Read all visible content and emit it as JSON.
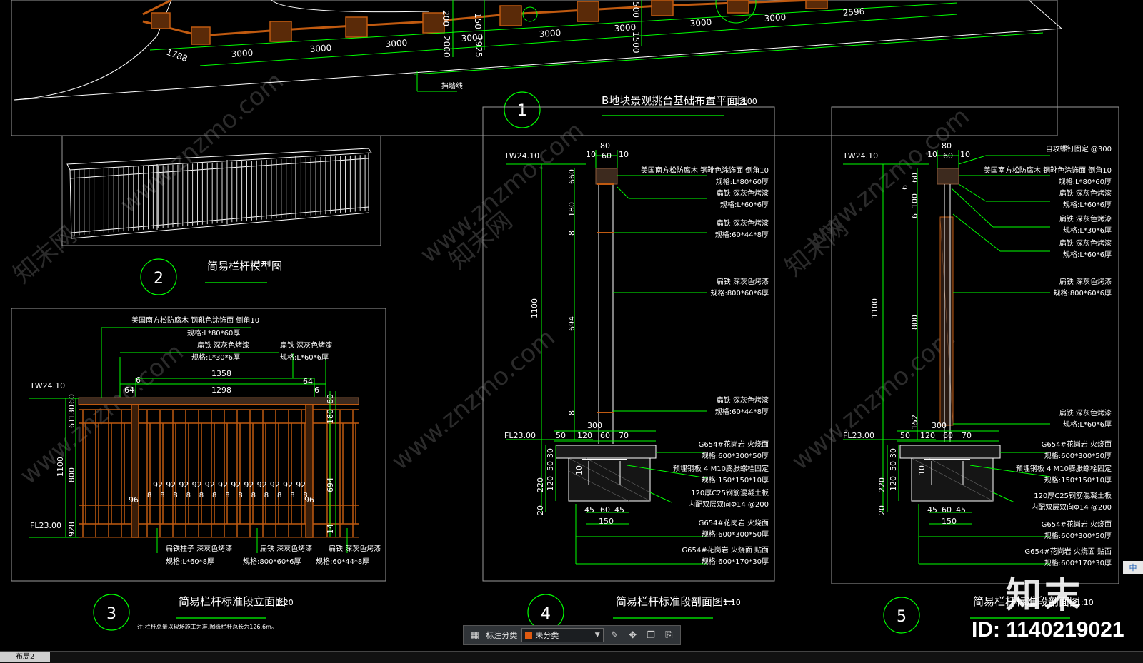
{
  "colors": {
    "line": "#ffffff",
    "dim": "#00ff00",
    "wood": "#c05a10",
    "hatch": "#8a5a3a",
    "frame": "#9a9a9a",
    "accent": "#e05a10"
  },
  "plan": {
    "dims_bottom": [
      "1788",
      "3000",
      "3000",
      "3000",
      "3000",
      "3000",
      "3000",
      "3000",
      "2596"
    ],
    "dims_mid": [
      "200",
      "150",
      "2000",
      "3000",
      "1925",
      "500",
      "1500"
    ],
    "marker": "1",
    "title": "B地块景观挑台基础布置平面图",
    "scale": "1:100",
    "note": "挡墙线"
  },
  "model": {
    "marker": "2",
    "title": "简易栏杆模型图"
  },
  "elevation": {
    "marker": "3",
    "title": "简易栏杆标准段立面图",
    "scale": "1:20",
    "note": "注:栏杆总量以现场施工为准,图纸栏杆总长为126.6m。",
    "top_label": "TW24.10",
    "bottom_label": "FL23.00",
    "labels": {
      "wood_top": "美国南方松防腐木 钢靴色涂饰面 倒角10",
      "wood_spec": "规格:L*80*60厚",
      "flat_a": "扁铁 深灰色烤漆",
      "flat_a_spec": "规格:L*30*6厚",
      "flat_b": "扁铁 深灰色烤漆",
      "flat_b_spec": "规格:L*60*6厚",
      "post": "扁铁柱子 深灰色烤漆",
      "post_spec": "规格:L*60*8厚",
      "bar": "扁铁 深灰色烤漆",
      "bar_spec": "规格:800*60*6厚",
      "base": "扁铁 深灰色烤漆",
      "base_spec": "规格:60*44*8厚"
    },
    "dims": {
      "d1358": "1358",
      "d1298": "1298",
      "d64a": "64",
      "d64b": "64",
      "d6": "6",
      "d6b": "6",
      "d1100": "1100",
      "d800": "800",
      "d60": "60",
      "d130": "130",
      "d61": "61",
      "d928": "928",
      "d694": "694",
      "d180": "180",
      "d96a": "96",
      "d96b": "96",
      "d14": "14"
    },
    "spacing": [
      "92",
      "92",
      "92",
      "92",
      "92",
      "92",
      "92",
      "92",
      "92",
      "92",
      "92",
      "92"
    ],
    "eights": [
      "8",
      "8",
      "8",
      "8",
      "8",
      "8",
      "8",
      "8",
      "8",
      "8",
      "8",
      "8",
      "8"
    ]
  },
  "section1": {
    "marker": "4",
    "title": "简易栏杆标准段剖面图一",
    "scale": "1:10",
    "top_label": "TW24.10",
    "bottom_label": "FL23.00",
    "dims": {
      "d80": "80",
      "d10a": "10",
      "d60": "60",
      "d10b": "10",
      "d660": "660",
      "d180": "180",
      "d8a": "8",
      "d1100": "1100",
      "d694": "694",
      "d8b": "8",
      "d300": "300",
      "d50": "50",
      "d120": "120",
      "d60b": "60",
      "d70": "70",
      "d30": "30",
      "d50b": "50",
      "d220": "220",
      "d120b": "120",
      "d20": "20",
      "d45a": "45",
      "d60c": "60",
      "d45b": "45",
      "d150": "150",
      "d10c": "10"
    },
    "labels": [
      "美国南方松防腐木 钢靴色涂饰面 倒角10",
      "规格:L*80*60厚",
      "扁铁 深灰色烤漆",
      "规格:L*60*6厚",
      "扁铁 深灰色烤漆",
      "规格:60*44*8厚",
      "扁铁 深灰色烤漆",
      "规格:800*60*6厚",
      "扁铁 深灰色烤漆",
      "规格:60*44*8厚",
      "G654#花岗岩 火烧面",
      "规格:600*300*50厚",
      "预埋钢板 4 M10膨胀螺栓固定",
      "规格:150*150*10厚",
      "120厚C25钢筋混凝土板",
      "内配双层双向Φ14 @200",
      "G654#花岗岩 火烧面",
      "规格:600*300*50厚",
      "G654#花岗岩 火烧面 贴面",
      "规格:600*170*30厚"
    ]
  },
  "section2": {
    "marker": "5",
    "title": "简易栏杆标准段剖面图",
    "scale": "1:10",
    "top_label": "TW24.10",
    "bottom_label": "FL23.00",
    "dims": {
      "d80": "80",
      "d10a": "10",
      "d60": "60",
      "d10b": "10",
      "d60v": "60",
      "d6": "6",
      "d100": "100",
      "d6b": "6",
      "d1100": "1100",
      "d800": "800",
      "d300": "300",
      "d50": "50",
      "d120": "120",
      "d60b": "60",
      "d70": "70",
      "d30": "30",
      "d50b": "50",
      "d220": "220",
      "d120b": "120",
      "d20": "20",
      "d45a": "45",
      "d60c": "60",
      "d45b": "45",
      "d150": "150",
      "d10": "10",
      "d6c": "6",
      "d152": "152"
    },
    "labels": [
      "自攻螺钉固定 @300",
      "美国南方松防腐木 钢靴色涂饰面 倒角10",
      "规格:L*80*60厚",
      "扁铁 深灰色烤漆",
      "规格:L*60*6厚",
      "扁铁 深灰色烤漆",
      "规格:L*30*6厚",
      "扁铁 深灰色烤漆",
      "规格:L*60*6厚",
      "扁铁 深灰色烤漆",
      "规格:800*60*6厚",
      "扁铁 深灰色烤漆",
      "规格:L*60*6厚",
      "G654#花岗岩 火烧面",
      "规格:600*300*50厚",
      "预埋钢板 4 M10膨胀螺栓固定",
      "规格:150*150*10厚",
      "120厚C25钢筋混凝土板",
      "内配双层双向Φ14 @200",
      "G654#花岗岩 火烧面",
      "规格:600*300*50厚",
      "G654#花岗岩 火烧面 贴面",
      "规格:600*170*30厚"
    ]
  },
  "toolbar": {
    "label": "标注分类",
    "select_value": "未分类"
  },
  "layout_tab": "布局2",
  "watermark": {
    "site": "www.znzmo.com",
    "cn": "知末网",
    "brand": "知末",
    "id": "ID: 1140219021"
  },
  "ime": "中"
}
